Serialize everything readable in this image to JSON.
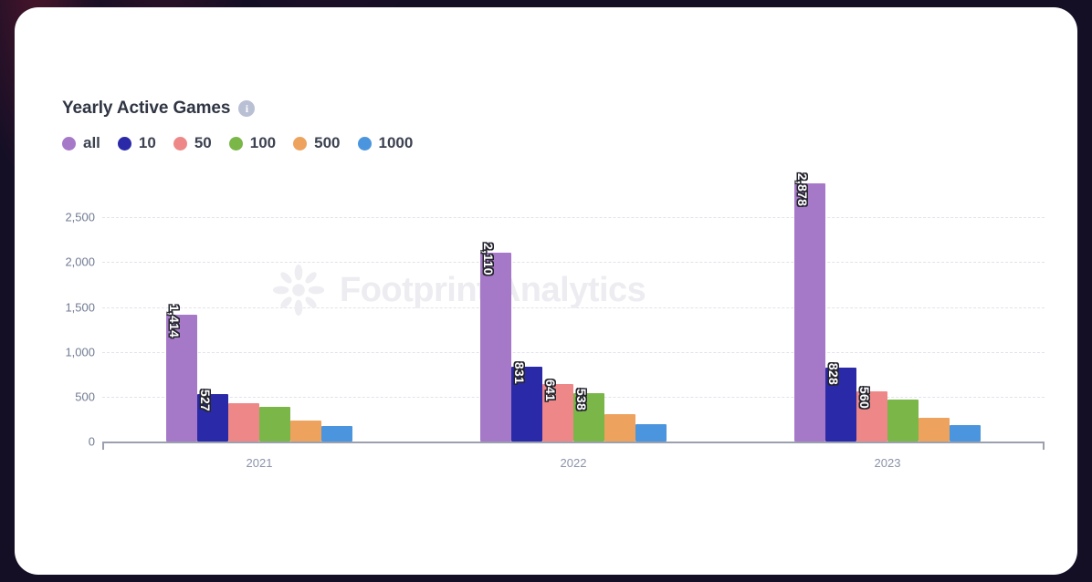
{
  "card": {
    "background": "#ffffff",
    "page_background": "#150f26"
  },
  "header": {
    "title": "Yearly Active Games",
    "info_icon": "info-icon",
    "info_glyph": "i"
  },
  "watermark": {
    "text": "Footprint Analytics",
    "logo": "sunburst-logo"
  },
  "chart_data": {
    "type": "bar",
    "title": "Yearly Active Games",
    "xlabel": "",
    "ylabel": "",
    "categories": [
      "2021",
      "2022",
      "2023"
    ],
    "ylim": [
      0,
      2900
    ],
    "yticks": [
      0,
      500,
      1000,
      1500,
      2000,
      2500
    ],
    "ytick_labels": [
      "0",
      "500",
      "1,000",
      "1,500",
      "2,000",
      "2,500"
    ],
    "grid": true,
    "legend_position": "top-left",
    "series": [
      {
        "name": "all",
        "color": "#a679c8",
        "values": [
          1414,
          2110,
          2878
        ],
        "labels": [
          "1,414",
          "2,110",
          "2,878"
        ]
      },
      {
        "name": "10",
        "color": "#2a2aa8",
        "values": [
          527,
          831,
          828
        ],
        "labels": [
          "527",
          "831",
          "828"
        ]
      },
      {
        "name": "50",
        "color": "#ee8888",
        "values": [
          424,
          641,
          560
        ],
        "labels": [
          "",
          "641",
          "560"
        ]
      },
      {
        "name": "100",
        "color": "#7ab648",
        "values": [
          385,
          538,
          470
        ],
        "labels": [
          "",
          "538",
          ""
        ]
      },
      {
        "name": "500",
        "color": "#eda35e",
        "values": [
          230,
          310,
          265
        ],
        "labels": [
          "",
          "",
          ""
        ]
      },
      {
        "name": "1000",
        "color": "#4a95dd",
        "values": [
          175,
          195,
          180
        ],
        "labels": [
          "",
          "",
          ""
        ]
      }
    ]
  }
}
